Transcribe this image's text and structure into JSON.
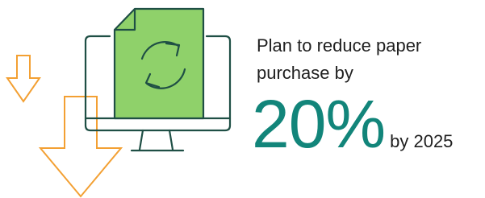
{
  "headline": {
    "line1": "Plan to reduce paper",
    "line2": "purchase by"
  },
  "stat": {
    "value": "20%",
    "suffix": "by 2025"
  },
  "icons": {
    "monitor": "monitor-icon",
    "document": "document-icon",
    "refresh": "refresh-icon",
    "arrows": "down-arrow-icon"
  },
  "colors": {
    "accent_teal": "#12857a",
    "monitor_stroke": "#1f4f45",
    "document_fill": "#8fd16a",
    "arrow_orange": "#f3a033",
    "text": "#1f1f1f"
  }
}
